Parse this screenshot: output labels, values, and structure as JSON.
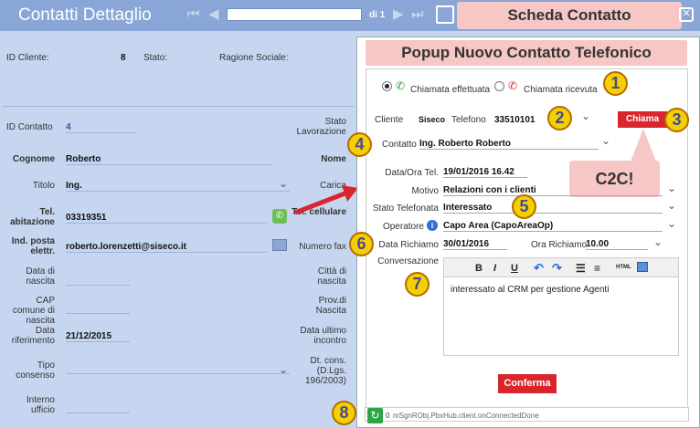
{
  "app": {
    "title": "Contatti Dettaglio",
    "record_of": "di 1",
    "nav_first": "⏮",
    "nav_prev": "◀",
    "nav_next": "▶",
    "nav_last": "⏭"
  },
  "callouts": {
    "scheda": "Scheda Contatto",
    "popup": "Popup Nuovo Contatto Telefonico",
    "c2c": "C2C!",
    "badges": [
      "1",
      "2",
      "3",
      "4",
      "5",
      "6",
      "7",
      "8"
    ]
  },
  "top": {
    "id_cliente_label": "ID Cliente:",
    "id_cliente_value": "8",
    "stato_label": "Stato:",
    "ragione_label": "Ragione Sociale:"
  },
  "form": {
    "id_contatto_label": "ID Contatto",
    "id_contatto_value": "4",
    "stato_lav_label": "Stato Lavorazione",
    "cognome_label": "Cognome",
    "cognome_value": "Roberto",
    "nome_label": "Nome",
    "titolo_label": "Titolo",
    "titolo_value": "Ing.",
    "carica_label": "Carica",
    "tel_ab_label": "Tel. abitazione",
    "tel_ab_value": "03319351",
    "tel_cell_label": "Tel. cellulare",
    "email_label": "Ind. posta elettr.",
    "email_value": "roberto.lorenzetti@siseco.it",
    "fax_label": "Numero fax",
    "data_nascita_label": "Data di nascita",
    "citta_label": "Città di nascita",
    "cap_label": "CAP comune di nascita",
    "prov_label": "Prov.di Nascita",
    "data_rif_label": "Data riferimento",
    "data_rif_value": "21/12/2015",
    "data_ultimo_label": "Data ultimo incontro",
    "tipo_consenso_label": "Tipo consenso",
    "dt_cons_label": "Dt. cons. (D.Lgs. 196/2003)",
    "interno_label": "Interno ufficio"
  },
  "popup": {
    "radio_out": "Chiamata effettuata",
    "radio_in": "Chiamata ricevuta",
    "cliente_label": "Cliente",
    "cliente_value": "Siseco",
    "telefono_label": "Telefono",
    "telefono_value": "33510101",
    "chiama": "Chiama",
    "contatto_label": "Contatto",
    "contatto_value": "Ing. Roberto Roberto",
    "data_ora_label": "Data/Ora Tel.",
    "data_ora_value": "19/01/2016 16.42",
    "motivo_label": "Motivo",
    "motivo_value": "Relazioni con i clienti",
    "stato_label": "Stato Telefonata",
    "stato_value": "Interessato",
    "operatore_label": "Operatore",
    "operatore_value": "Capo Area (CapoAreaOp)",
    "data_richiamo_label": "Data Richiamo",
    "data_richiamo_value": "30/01/2016",
    "ora_richiamo_label": "Ora Richiamo",
    "ora_richiamo_value": "10.00",
    "conversazione_label": "Conversazione",
    "toolbar": {
      "bold": "B",
      "italic": "I",
      "underline": "U",
      "undo": "↶",
      "redo": "↷",
      "html": "HTML"
    },
    "conversazione_value": "interessato al CRM per gestione Agenti",
    "conferma": "Conferma",
    "status_num": "0",
    "status_text": "mSgnRObj.PbxHub.client.onConnectedDone"
  },
  "colors": {
    "accent_red": "#d8262c",
    "callout_pink": "#f6c7c4",
    "badge_yellow": "#f5d000",
    "bg_blue": "#c6d6f0"
  }
}
